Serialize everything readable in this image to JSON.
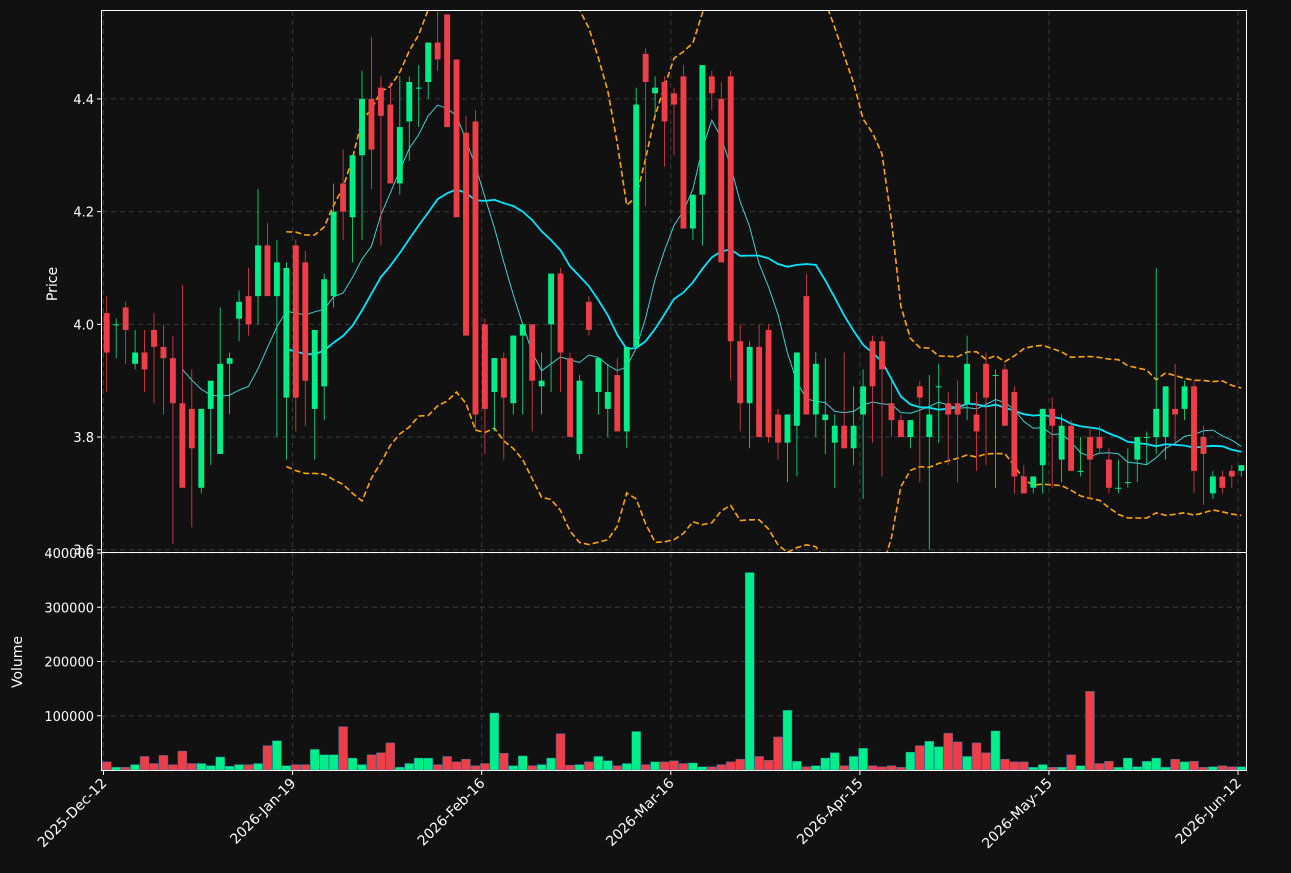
{
  "chart_data": {
    "type": "candlestick",
    "price_panel": {
      "ylabel": "Price",
      "ylim": [
        3.596,
        4.556
      ],
      "yticks": [
        "3.6",
        "3.8",
        "4.0",
        "4.2",
        "4.4"
      ],
      "grid": true
    },
    "volume_panel": {
      "ylabel": "Volume",
      "ylim": [
        0,
        400000
      ],
      "yticks": [
        "100000",
        "200000",
        "300000",
        "400000"
      ],
      "grid": true
    },
    "xticks": [
      {
        "label": "2025-Dec-12",
        "index": 0
      },
      {
        "label": "2026-Jan-19",
        "index": 20
      },
      {
        "label": "2026-Feb-16",
        "index": 40
      },
      {
        "label": "2026-Mar-16",
        "index": 60
      },
      {
        "label": "2026-Apr-15",
        "index": 80
      },
      {
        "label": "2026-May-15",
        "index": 100
      },
      {
        "label": "2026-Jun-12",
        "index": 120
      }
    ],
    "candles": {
      "open": [
        4.02,
        4.0,
        4.03,
        3.93,
        3.95,
        3.99,
        3.96,
        3.94,
        3.86,
        3.85,
        3.71,
        3.85,
        3.77,
        3.93,
        4.01,
        4.05,
        4.05,
        4.14,
        4.05,
        3.87,
        4.14,
        4.11,
        3.85,
        3.89,
        4.05,
        4.25,
        4.19,
        4.3,
        4.4,
        4.42,
        4.39,
        4.25,
        4.36,
        4.42,
        4.43,
        4.5,
        4.55,
        4.47,
        4.34,
        4.36,
        4.0,
        3.88,
        3.94,
        3.86,
        3.98,
        4.0,
        3.89,
        4.0,
        4.09,
        3.94,
        3.77,
        4.04,
        3.88,
        3.85,
        3.91,
        3.81,
        3.96,
        4.48,
        4.41,
        4.43,
        4.41,
        4.44,
        4.17,
        4.23,
        4.44,
        4.4,
        4.44,
        3.97,
        3.86,
        3.96,
        3.99,
        3.84,
        3.79,
        3.82,
        4.05,
        3.84,
        3.83,
        3.79,
        3.82,
        3.78,
        3.84,
        3.97,
        3.97,
        3.86,
        3.83,
        3.8,
        3.89,
        3.8,
        3.89,
        3.86,
        3.86,
        3.86,
        3.84,
        3.93,
        3.91,
        3.92,
        3.88,
        3.73,
        3.71,
        3.75,
        3.85,
        3.76,
        3.82,
        3.74,
        3.8,
        3.8,
        3.76,
        3.71,
        3.72,
        3.76,
        3.8,
        3.8,
        3.8,
        3.85,
        3.85,
        3.89,
        3.8,
        3.7,
        3.73,
        3.74,
        3.74
      ],
      "high": [
        4.05,
        4.01,
        4.04,
        3.99,
        3.99,
        4.02,
        4.0,
        3.98,
        4.07,
        3.92,
        3.8,
        3.87,
        4.03,
        3.95,
        4.06,
        4.1,
        4.24,
        4.18,
        4.15,
        4.11,
        4.15,
        4.13,
        3.91,
        4.09,
        4.25,
        4.31,
        4.27,
        4.45,
        4.51,
        4.44,
        4.43,
        4.44,
        4.44,
        4.46,
        4.5,
        4.56,
        4.55,
        4.47,
        4.37,
        4.38,
        4.01,
        3.9,
        3.95,
        3.98,
        4.0,
        4.0,
        3.95,
        4.01,
        4.1,
        3.95,
        3.91,
        4.05,
        3.94,
        3.93,
        3.94,
        3.95,
        4.42,
        4.49,
        4.44,
        4.44,
        4.42,
        4.46,
        4.23,
        4.46,
        4.45,
        4.43,
        4.45,
        4.0,
        3.97,
        4.0,
        4.0,
        3.85,
        3.81,
        3.93,
        4.09,
        3.95,
        3.94,
        3.84,
        3.95,
        3.89,
        3.92,
        3.98,
        3.98,
        3.9,
        3.84,
        3.8,
        3.9,
        3.91,
        3.93,
        3.88,
        3.9,
        3.98,
        3.88,
        3.95,
        3.92,
        3.93,
        3.89,
        3.75,
        3.73,
        3.85,
        3.87,
        3.84,
        3.83,
        3.8,
        3.82,
        3.82,
        3.78,
        3.76,
        3.78,
        3.8,
        3.81,
        4.1,
        3.88,
        3.93,
        3.9,
        3.9,
        3.82,
        3.74,
        3.74,
        3.75,
        3.75
      ],
      "low": [
        3.88,
        3.94,
        3.93,
        3.92,
        3.88,
        3.86,
        3.84,
        3.61,
        3.77,
        3.64,
        3.7,
        3.75,
        3.77,
        3.84,
        3.97,
        3.98,
        4.0,
        4.05,
        3.8,
        3.76,
        3.81,
        3.82,
        3.76,
        3.83,
        4.03,
        4.15,
        4.11,
        4.15,
        4.24,
        4.14,
        4.3,
        4.23,
        4.29,
        4.35,
        4.4,
        4.45,
        4.38,
        4.33,
        4.04,
        3.81,
        3.77,
        3.81,
        3.76,
        3.84,
        3.84,
        3.81,
        3.84,
        3.88,
        3.88,
        3.83,
        3.76,
        3.98,
        3.84,
        3.8,
        3.84,
        3.78,
        3.96,
        4.21,
        4.37,
        4.28,
        4.3,
        4.18,
        4.15,
        4.14,
        4.38,
        4.25,
        3.9,
        3.81,
        3.78,
        3.81,
        3.79,
        3.76,
        3.72,
        3.73,
        3.92,
        3.8,
        3.77,
        3.71,
        3.79,
        3.75,
        3.69,
        3.79,
        3.73,
        3.8,
        3.82,
        3.78,
        3.72,
        3.6,
        3.79,
        3.75,
        3.72,
        3.83,
        3.74,
        3.75,
        3.71,
        3.82,
        3.7,
        3.72,
        3.7,
        3.7,
        3.71,
        3.72,
        3.75,
        3.73,
        3.69,
        3.77,
        3.7,
        3.7,
        3.71,
        3.72,
        3.75,
        3.77,
        3.76,
        3.79,
        3.83,
        3.7,
        3.68,
        3.69,
        3.7,
        3.71,
        3.73
      ],
      "close": [
        3.95,
        4.0,
        3.99,
        3.95,
        3.92,
        3.96,
        3.94,
        3.86,
        3.71,
        3.78,
        3.85,
        3.9,
        3.93,
        3.94,
        4.04,
        4.0,
        4.14,
        4.05,
        4.11,
        4.1,
        3.87,
        3.9,
        3.99,
        4.08,
        4.2,
        4.2,
        4.3,
        4.4,
        4.31,
        4.37,
        4.25,
        4.35,
        4.43,
        4.42,
        4.5,
        4.47,
        4.35,
        4.19,
        3.98,
        3.84,
        3.85,
        3.94,
        3.87,
        3.98,
        4.0,
        3.9,
        3.9,
        4.09,
        3.95,
        3.8,
        3.9,
        3.99,
        3.94,
        3.88,
        3.81,
        3.96,
        4.39,
        4.43,
        4.42,
        4.36,
        4.39,
        4.17,
        4.23,
        4.46,
        4.41,
        4.11,
        3.97,
        3.86,
        3.96,
        3.8,
        3.8,
        3.79,
        3.84,
        3.95,
        3.84,
        3.93,
        3.84,
        3.82,
        3.78,
        3.82,
        3.89,
        3.89,
        3.92,
        3.83,
        3.8,
        3.83,
        3.87,
        3.84,
        3.89,
        3.84,
        3.84,
        3.93,
        3.81,
        3.87,
        3.91,
        3.82,
        3.73,
        3.7,
        3.73,
        3.85,
        3.82,
        3.82,
        3.74,
        3.74,
        3.76,
        3.78,
        3.71,
        3.71,
        3.72,
        3.8,
        3.8,
        3.85,
        3.89,
        3.84,
        3.89,
        3.74,
        3.77,
        3.73,
        3.71,
        3.73,
        3.75
      ]
    },
    "volume": [
      15000,
      5000,
      5000,
      10000,
      25000,
      12000,
      27000,
      10000,
      35000,
      12000,
      12000,
      8000,
      24000,
      7000,
      10000,
      10000,
      12000,
      45000,
      54000,
      8000,
      10000,
      10000,
      38000,
      28000,
      28000,
      80000,
      22000,
      10000,
      28000,
      32000,
      50000,
      5000,
      12000,
      22000,
      22000,
      10000,
      25000,
      15000,
      20000,
      8000,
      12000,
      105000,
      31000,
      8000,
      26000,
      8000,
      10000,
      22000,
      67000,
      9000,
      10000,
      15000,
      25000,
      17000,
      8000,
      12000,
      71000,
      10000,
      15000,
      15000,
      17000,
      12000,
      13000,
      6000,
      6000,
      10000,
      15000,
      20000,
      364000,
      25000,
      18000,
      61000,
      110000,
      16000,
      6000,
      8000,
      22000,
      32000,
      8000,
      25000,
      40000,
      8000,
      6000,
      8000,
      5000,
      33000,
      45000,
      53000,
      43000,
      68000,
      52000,
      25000,
      50000,
      32000,
      72000,
      20000,
      15000,
      15000,
      5000,
      10000,
      5000,
      5000,
      28000,
      8000,
      145000,
      12000,
      16000,
      5000,
      22000,
      6000,
      16000,
      22000,
      5000,
      20000,
      15000,
      16000,
      5000,
      6000,
      8000,
      6000,
      6000
    ],
    "colors": {
      "background": "#111111",
      "up": "#00ee88",
      "down": "#ee3e48",
      "ma_fast": "#3cd0d0",
      "ma_slow": "#00e5ff",
      "bands": "#ffa500",
      "grid": "#3a3a3a",
      "axis": "#ffffff"
    },
    "overlays": [
      "moving-average-fast",
      "moving-average-slow",
      "upper-band",
      "lower-band"
    ]
  }
}
